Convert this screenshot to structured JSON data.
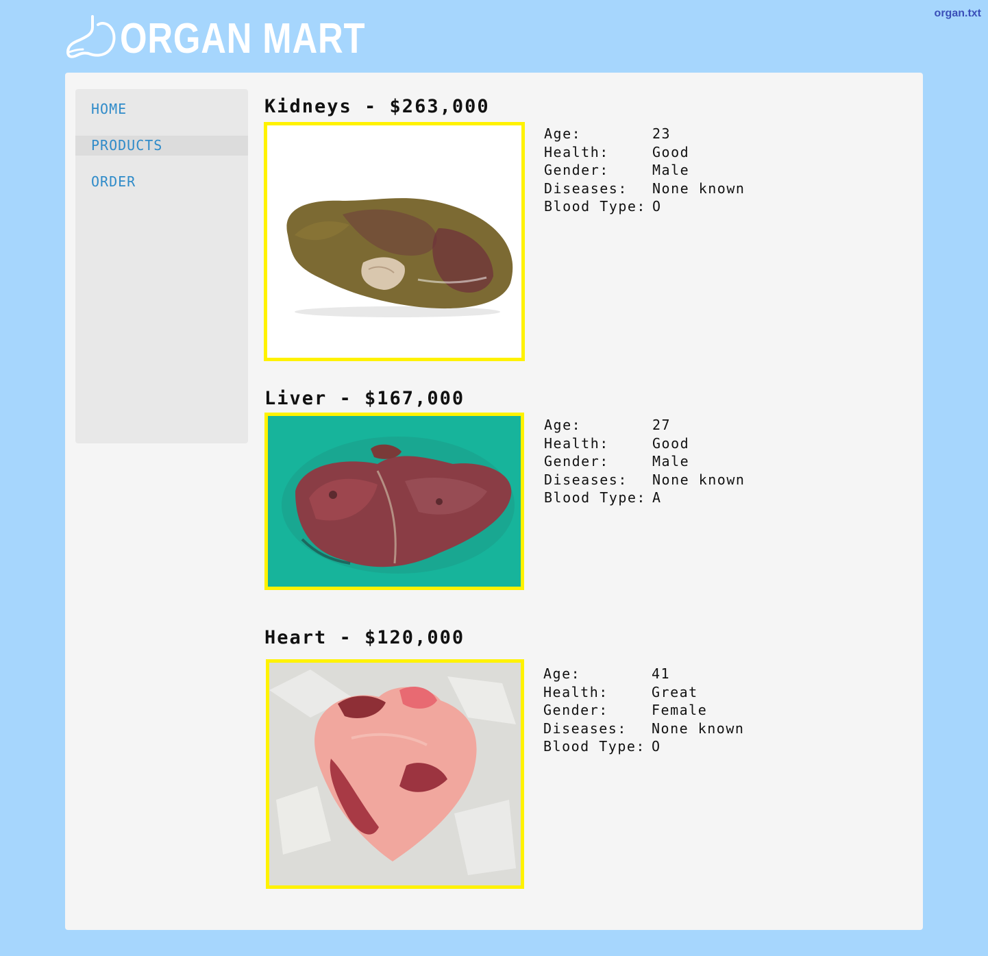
{
  "header": {
    "logo_text": "ORGAN MART",
    "logo_icon": "stomach-icon",
    "top_link": "organ.txt"
  },
  "nav": {
    "items": [
      {
        "label": "HOME"
      },
      {
        "label": "PRODUCTS",
        "active": true
      },
      {
        "label": "ORDER"
      }
    ]
  },
  "colors": {
    "background": "#a6d6fd",
    "panel": "#f5f5f5",
    "sidebar": "#e8e8e8",
    "nav_link": "#2f8bc9",
    "image_border": "#fff200"
  },
  "spec_labels": {
    "age": "Age:",
    "health": "Health:",
    "gender": "Gender:",
    "diseases": "Diseases:",
    "blood_type": "Blood Type:"
  },
  "products": [
    {
      "title": "Kidneys - $263,000",
      "age": "23",
      "health": "Good",
      "gender": "Male",
      "diseases": "None known",
      "blood_type": "O"
    },
    {
      "title": "Liver - $167,000",
      "age": "27",
      "health": "Good",
      "gender": "Male",
      "diseases": "None known",
      "blood_type": "A"
    },
    {
      "title": "Heart - $120,000",
      "age": "41",
      "health": "Great",
      "gender": "Female",
      "diseases": "None known",
      "blood_type": "O"
    }
  ]
}
